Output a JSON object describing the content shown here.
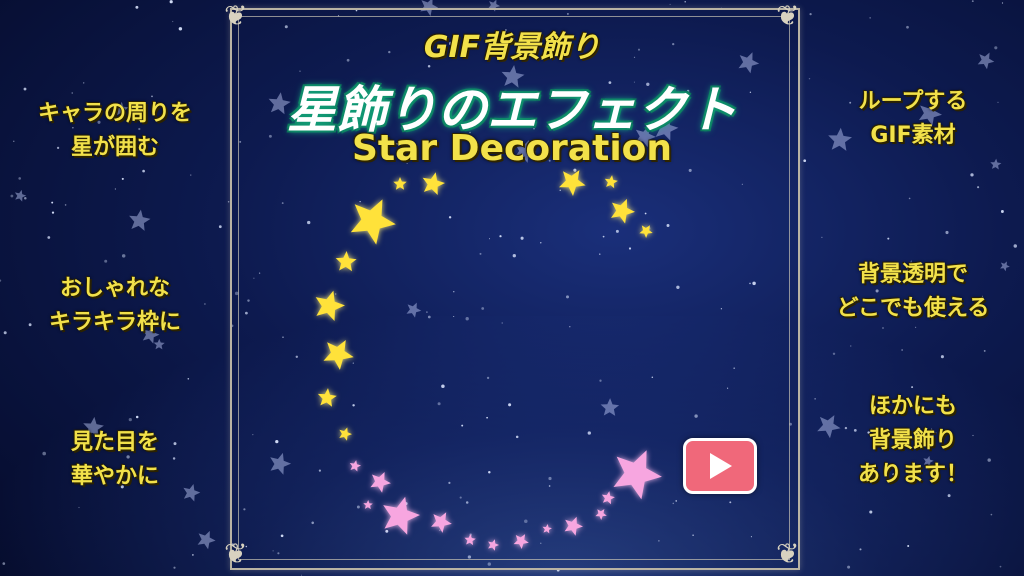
{
  "title": {
    "top": "GIF背景飾り",
    "main": "星飾りのエフェクト",
    "sub": "Star Decoration"
  },
  "left_notes": [
    {
      "line1": "キャラの周りを",
      "line2": "星が囲む"
    },
    {
      "line1": "おしゃれな",
      "line2": "キラキラ枠に"
    },
    {
      "line1": "見た目を",
      "line2": "華やかに"
    }
  ],
  "right_notes": [
    {
      "line1": "ループする",
      "line2": "GIF素材"
    },
    {
      "line1": "背景透明で",
      "line2": "どこでも使える"
    },
    {
      "line1": "ほかにも",
      "line2": "背景飾り",
      "line3": "あります！"
    }
  ],
  "colors": {
    "yellow_star": "#ffe23a",
    "pink_star": "#f7a6e0",
    "play_button": "#f0687a",
    "text_yellow": "#f2e14a"
  },
  "icons": {
    "play": "play-triangle-icon",
    "corner": "ornament-icon"
  }
}
